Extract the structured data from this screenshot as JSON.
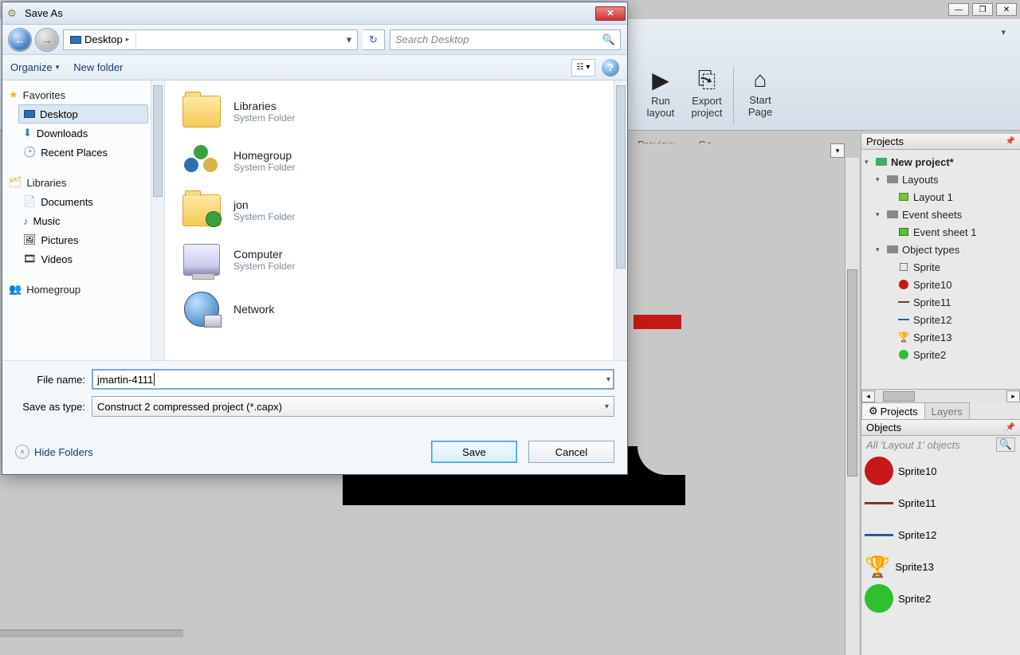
{
  "ribbon": {
    "run_layout": "Run layout",
    "export_project": "Export project",
    "start_page": "Start Page",
    "preview": "Preview",
    "go": "Go"
  },
  "projects_panel": {
    "title": "Projects",
    "root": "New project*",
    "layouts": "Layouts",
    "layout1": "Layout 1",
    "event_sheets": "Event sheets",
    "event_sheet1": "Event sheet 1",
    "object_types": "Object types",
    "sprite": "Sprite",
    "sprite10": "Sprite10",
    "sprite11": "Sprite11",
    "sprite12": "Sprite12",
    "sprite13": "Sprite13",
    "sprite2": "Sprite2",
    "tab_projects": "Projects",
    "tab_layers": "Layers"
  },
  "objects_panel": {
    "title": "Objects",
    "filter": "All 'Layout 1' objects",
    "sprite10": "Sprite10",
    "sprite11": "Sprite11",
    "sprite12": "Sprite12",
    "sprite13": "Sprite13",
    "sprite2": "Sprite2"
  },
  "dialog": {
    "title": "Save As",
    "breadcrumb": "Desktop",
    "search_placeholder": "Search Desktop",
    "organize": "Organize",
    "new_folder": "New folder",
    "sidebar": {
      "favorites": "Favorites",
      "desktop": "Desktop",
      "downloads": "Downloads",
      "recent_places": "Recent Places",
      "libraries": "Libraries",
      "documents": "Documents",
      "music": "Music",
      "pictures": "Pictures",
      "videos": "Videos",
      "homegroup": "Homegroup"
    },
    "items": {
      "libraries": "Libraries",
      "homegroup": "Homegroup",
      "jon": "jon",
      "computer": "Computer",
      "network": "Network",
      "system_folder": "System Folder"
    },
    "file_name_label": "File name:",
    "file_name_value": "jmartin-4111",
    "save_as_type_label": "Save as type:",
    "save_as_type_value": "Construct 2 compressed project (*.capx)",
    "hide_folders": "Hide Folders",
    "save": "Save",
    "cancel": "Cancel"
  }
}
